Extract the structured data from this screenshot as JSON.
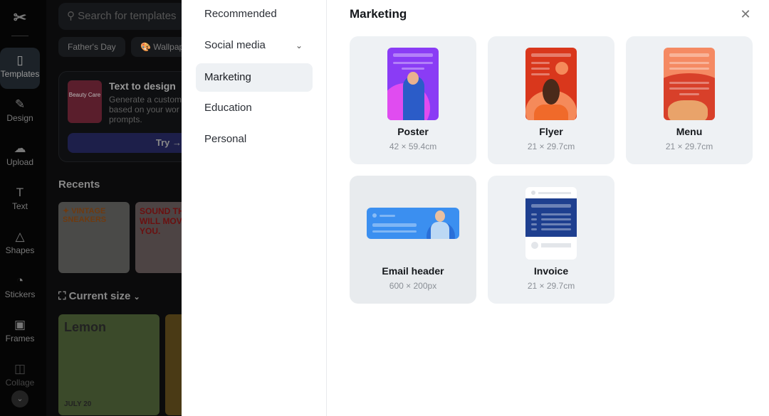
{
  "sidebar": {
    "items": [
      {
        "label": "Templates",
        "icon": "templates-icon",
        "active": true
      },
      {
        "label": "Design",
        "icon": "design-icon"
      },
      {
        "label": "Upload",
        "icon": "upload-icon"
      },
      {
        "label": "Text",
        "icon": "text-icon"
      },
      {
        "label": "Shapes",
        "icon": "shapes-icon"
      },
      {
        "label": "Stickers",
        "icon": "stickers-icon"
      },
      {
        "label": "Frames",
        "icon": "frames-icon"
      },
      {
        "label": "Collage",
        "icon": "collage-icon"
      }
    ]
  },
  "panel": {
    "search_placeholder": "Search for templates",
    "chips": [
      "Father's Day",
      "🎨 Wallpap"
    ],
    "text_to_design": {
      "thumb": "Beauty Care",
      "title": "Text to design",
      "desc": [
        "Generate a custom",
        "based on your wor",
        "prompts."
      ],
      "try": "Try →"
    },
    "recents": "Recents",
    "recent_thumbs": [
      "✦ VINTAGE SNEAKERS",
      "SOUND THAT WILL MOVE YOU."
    ],
    "current_size": "Current size",
    "size_thumbs": [
      "Lemon",
      "JULY 20"
    ]
  },
  "categories": [
    {
      "label": "Recommended"
    },
    {
      "label": "Social media",
      "expandable": true
    },
    {
      "label": "Marketing",
      "active": true
    },
    {
      "label": "Education"
    },
    {
      "label": "Personal"
    }
  ],
  "main": {
    "title": "Marketing",
    "cards": [
      {
        "name": "Poster",
        "size": "42 × 59.4cm",
        "color": "#8a3cf5"
      },
      {
        "name": "Flyer",
        "size": "21 × 29.7cm",
        "color": "#d9371c"
      },
      {
        "name": "Menu",
        "size": "21 × 29.7cm",
        "color": "#d8402a"
      },
      {
        "name": "Email header",
        "size": "600 × 200px",
        "color": "#3b8ff0"
      },
      {
        "name": "Invoice",
        "size": "21 × 29.7cm",
        "color": "#1e3f8f"
      }
    ]
  }
}
